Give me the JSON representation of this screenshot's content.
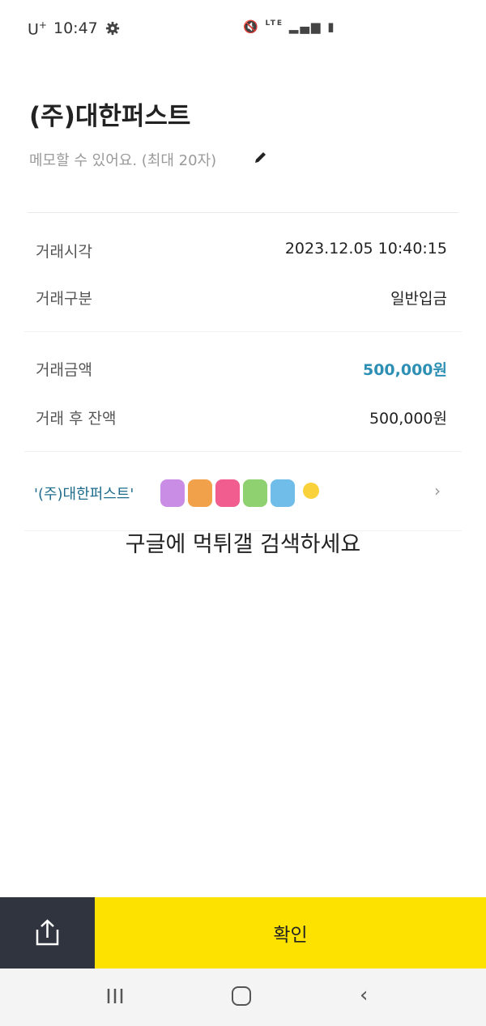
{
  "status_bar": {
    "carrier": "U",
    "carrier_sup": "+",
    "time": "10:47",
    "settings_icon": "gear-icon",
    "mute_icon": "mute-icon",
    "network_label": "LTE",
    "signal_icon": "signal-icon",
    "battery_icon": "battery-icon"
  },
  "header": {
    "title": "(주)대한퍼스트",
    "memo_placeholder": "메모할 수 있어요. (최대 20자)",
    "edit_icon": "pencil-icon"
  },
  "details": [
    {
      "label": "거래시각",
      "value": "2023.12.05 10:40:15"
    },
    {
      "label": "거래구분",
      "value": "일반입금"
    },
    {
      "label": "거래금액",
      "value": "500,000원"
    },
    {
      "label": "거래 후 잔액",
      "value": "500,000원"
    }
  ],
  "counterparty": {
    "label": "'(주)대한퍼스트'"
  },
  "watermark": {
    "logo": "MTGAL",
    "text": "구글에 먹튀갤 검색하세요"
  },
  "footer": {
    "share_icon": "share-icon",
    "confirm_label": "확인"
  },
  "colors": {
    "accent_yellow": "#fde200",
    "share_bg": "#30343f",
    "amount_blue": "#2e8fb5"
  }
}
